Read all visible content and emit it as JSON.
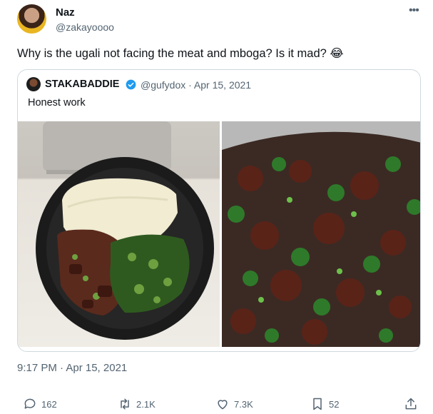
{
  "tweet": {
    "author_name": "Naz",
    "author_handle": "@zakayoooo",
    "more_icon": "more-horizontal-icon",
    "text": "Why is the ugali not facing the meat and mboga? Is it mad? 😂",
    "timestamp": "9:17 PM · Apr 15, 2021"
  },
  "quote": {
    "author_name": "STAKABADDIE",
    "verified": true,
    "handle_date": "@gufydox · Apr 15, 2021",
    "text": "Honest work"
  },
  "actions": {
    "replies": "162",
    "retweets": "2.1K",
    "likes": "7.3K",
    "bookmarks": "52"
  },
  "colors": {
    "verified_badge": "#1d9bf0",
    "secondary_text": "#536471",
    "border": "#cfd9de"
  }
}
